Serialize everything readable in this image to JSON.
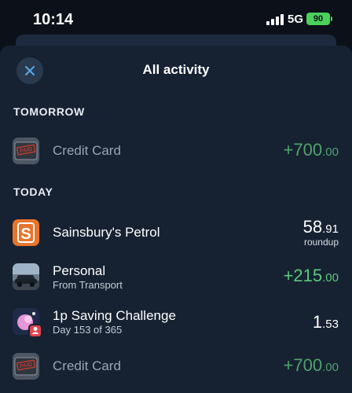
{
  "status_bar": {
    "time": "10:14",
    "network": "5G",
    "battery": "90"
  },
  "sheet": {
    "title": "All activity",
    "close_icon": "close-icon"
  },
  "sections": {
    "tomorrow": "TOMORROW",
    "today": "TODAY"
  },
  "tomorrow_items": [
    {
      "icon": "credit-card-paid-icon",
      "title": "Credit Card",
      "amount_main": "+700",
      "amount_decimal": ".00"
    }
  ],
  "today_items": [
    {
      "icon": "sainsburys-logo-icon",
      "title": "Sainsbury's Petrol",
      "amount_main": "58",
      "amount_decimal": ".91",
      "amount_note": "roundup"
    },
    {
      "icon": "car-photo-icon",
      "title": "Personal",
      "subtitle": "From Transport",
      "amount_main": "+215",
      "amount_decimal": ".00"
    },
    {
      "icon": "savings-challenge-icon",
      "title": "1p Saving Challenge",
      "subtitle": "Day 153 of 365",
      "amount_main": "1",
      "amount_decimal": ".53"
    },
    {
      "icon": "credit-card-paid-icon",
      "title": "Credit Card",
      "amount_main": "+700",
      "amount_decimal": ".00"
    }
  ],
  "colors": {
    "background": "#0b1019",
    "sheet": "#162232",
    "positive_amount": "#5cc97e",
    "battery": "#4bd05c",
    "sainsburys_orange": "#e8742c"
  }
}
